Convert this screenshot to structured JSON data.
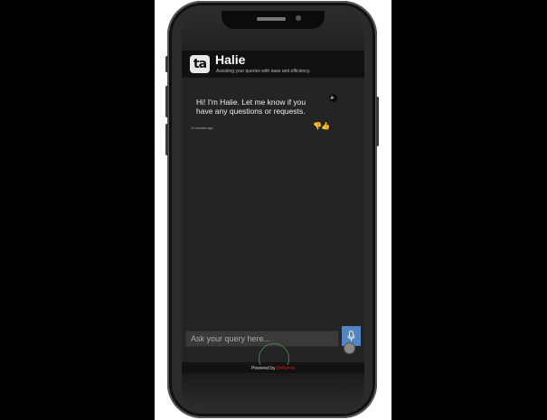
{
  "app": {
    "logo_text": "ta",
    "title": "Halie",
    "subtitle": "Assisting your queries with ease and efficiency."
  },
  "chat": {
    "messages": [
      {
        "text": "Hi! I'm Halie. Let me know if you have any questions or requests.",
        "timestamp": "24 minutes ago",
        "icons": [
          "speaker-icon",
          "thumbs-down-icon",
          "thumbs-up-icon"
        ]
      }
    ]
  },
  "input": {
    "placeholder": "Ask your query here..."
  },
  "footer": {
    "powered_label": "Powered by",
    "brand": "DrRunna"
  },
  "colors": {
    "mic_button": "#4f86c3",
    "brand": "#e02020",
    "chat_background": "#242424"
  }
}
